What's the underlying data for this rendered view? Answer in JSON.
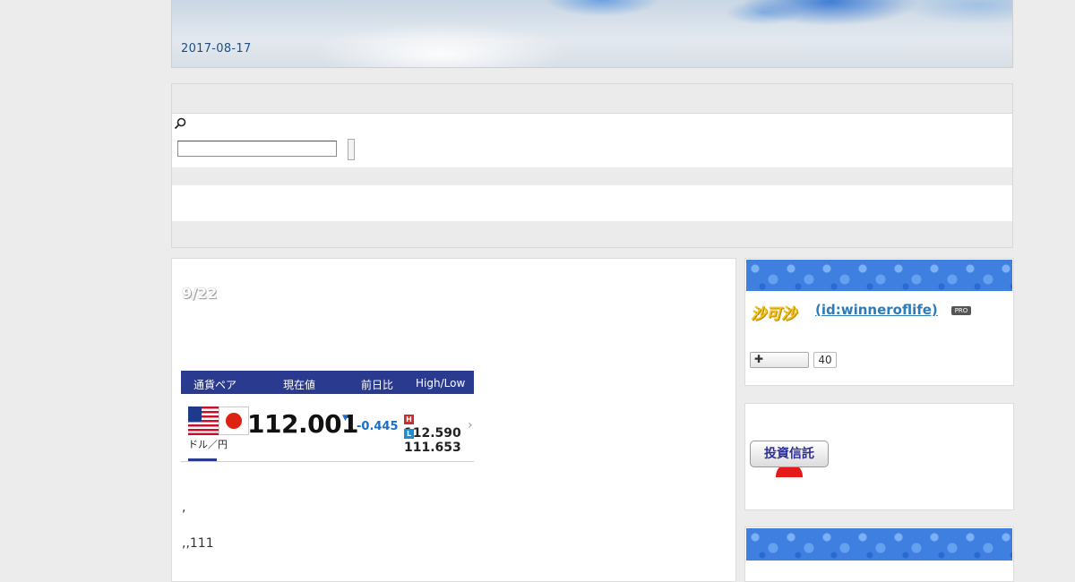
{
  "header": {
    "date": "2017-08-17"
  },
  "search": {
    "icon": "search-icon",
    "value": "",
    "placeholder": ""
  },
  "article": {
    "title": "9/22",
    "fx_widget": {
      "headers": [
        "通貨ペア",
        "現在値",
        "前日比",
        "High/Low"
      ],
      "pair": "ドル／円",
      "price": "112.001",
      "change": "-0.445",
      "high_tag": "H",
      "high": "112.590",
      "low_tag": "L",
      "low": "111.653",
      "colors": {
        "header_bg": "#2a3a8f",
        "change": "#1a6fc9",
        "high_tag": "#d32b2b",
        "low_tag": "#1a8fd6"
      }
    },
    "paragraphs": [
      ",",
      ",,111"
    ]
  },
  "profile": {
    "logo_icon": "blog-logo-icon",
    "user_id": " (id:winneroflife)",
    "badge": "PRO",
    "follow_icon": "plus-icon",
    "follow_label": "",
    "follower_count": "40"
  },
  "ad": {
    "label": "投資信託"
  },
  "colors": {
    "page_bg": "#ececec",
    "link": "#2e7bb8",
    "banner": "#3f7fe0"
  }
}
